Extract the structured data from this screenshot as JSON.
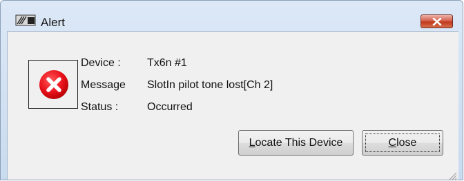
{
  "window": {
    "title": "Alert",
    "app_icon": "app-icon",
    "close_icon": "close-icon"
  },
  "alert": {
    "icon": "error-icon",
    "device_label": "Device :",
    "device_value": "Tx6n #1",
    "message_label": "Message",
    "message_value": "SlotIn pilot tone lost[Ch 2]",
    "status_label": "Status :",
    "status_value": "Occurred"
  },
  "buttons": {
    "locate_mnemonic": "L",
    "locate_rest": "ocate This Device",
    "close_mnemonic": "C",
    "close_rest": "lose"
  },
  "colors": {
    "error_red": "#e8101a",
    "close_button_red": "#c0381c"
  }
}
